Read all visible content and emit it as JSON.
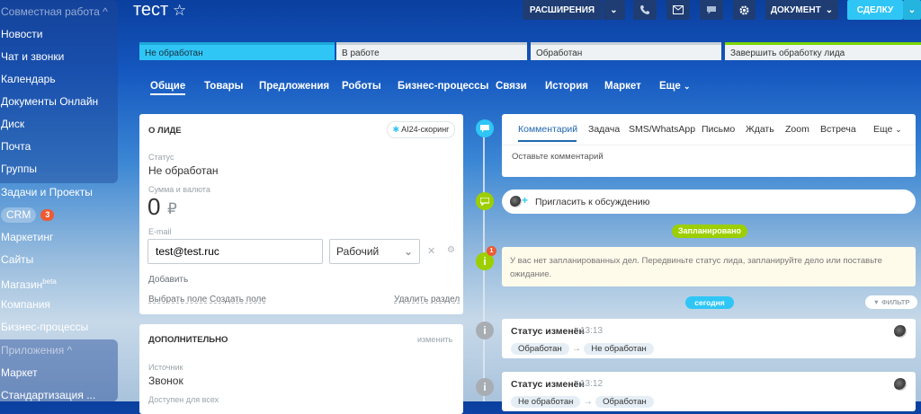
{
  "sidebar": {
    "items": [
      {
        "label": "Совместная работа ^"
      },
      {
        "label": "Новости"
      },
      {
        "label": "Чат и звонки"
      },
      {
        "label": "Календарь"
      },
      {
        "label": "Документы Онлайн"
      },
      {
        "label": "Диск"
      },
      {
        "label": "Почта"
      },
      {
        "label": "Группы"
      },
      {
        "label": "Задачи и Проекты"
      },
      {
        "label": "CRM",
        "badge": "3"
      },
      {
        "label": "Маркетинг"
      },
      {
        "label": "Сайты"
      },
      {
        "label": "Магазин",
        "sup": "beta"
      },
      {
        "label": "Компания"
      },
      {
        "label": "Бизнес-процессы"
      },
      {
        "label": "Приложения ^"
      },
      {
        "label": "Маркет"
      },
      {
        "label": "Стандартизация ..."
      }
    ]
  },
  "header": {
    "title": "тест",
    "extensions": "РАСШИРЕНИЯ",
    "document": "ДОКУМЕНТ",
    "deal": "СДЕЛКУ"
  },
  "stages": [
    "Не обработан",
    "В работе",
    "Обработан",
    "Завершить обработку лида"
  ],
  "tabs": [
    "Общие",
    "Товары",
    "Предложения",
    "Роботы",
    "Бизнес-процессы",
    "Связи",
    "История",
    "Маркет",
    "Еще"
  ],
  "about": {
    "heading": "О ЛИДЕ",
    "scoring": "AI24-скоринг",
    "status_label": "Статус",
    "status_value": "Не обработан",
    "sum_label": "Сумма и валюта",
    "sum_value": "0",
    "currency": "₽",
    "email_label": "E-mail",
    "email_value": "test@test.ruc",
    "email_type": "Рабочий",
    "add": "Добавить",
    "select_field": "Выбрать поле",
    "create_field": "Создать поле",
    "delete_section": "Удалить раздел"
  },
  "extra": {
    "heading": "ДОПОЛНИТЕЛЬНО",
    "edit": "изменить",
    "source_label": "Источник",
    "source_value": "Звонок",
    "avail_label": "Доступен для всех"
  },
  "activity": {
    "tabs": [
      "Комментарий",
      "Задача",
      "SMS/WhatsApp",
      "Письмо",
      "Ждать",
      "Zoom",
      "Встреча",
      "Еще"
    ],
    "placeholder": "Оставьте комментарий"
  },
  "timeline": {
    "invite": "Пригласить к обсуждению",
    "planned": "Запланировано",
    "planned_badge": "1",
    "empty_text": "У вас нет запланированных дел. Передвиньте статус лида, запланируйте дело или поставьте ожидание.",
    "today": "сегодня",
    "filter": "ФИЛЬТР",
    "events": [
      {
        "title": "Статус изменён",
        "time": "13:13",
        "from": "Обработан",
        "to": "Не обработан"
      },
      {
        "title": "Статус изменён",
        "time": "13:12",
        "from": "Не обработан",
        "to": "Обработан"
      }
    ]
  },
  "colors": {
    "accent": "#2fc6f6",
    "stage_active": "#2fc6f6",
    "stage_done": "#7bd500",
    "badge": "#ee5a33",
    "green": "#9dcf00"
  }
}
